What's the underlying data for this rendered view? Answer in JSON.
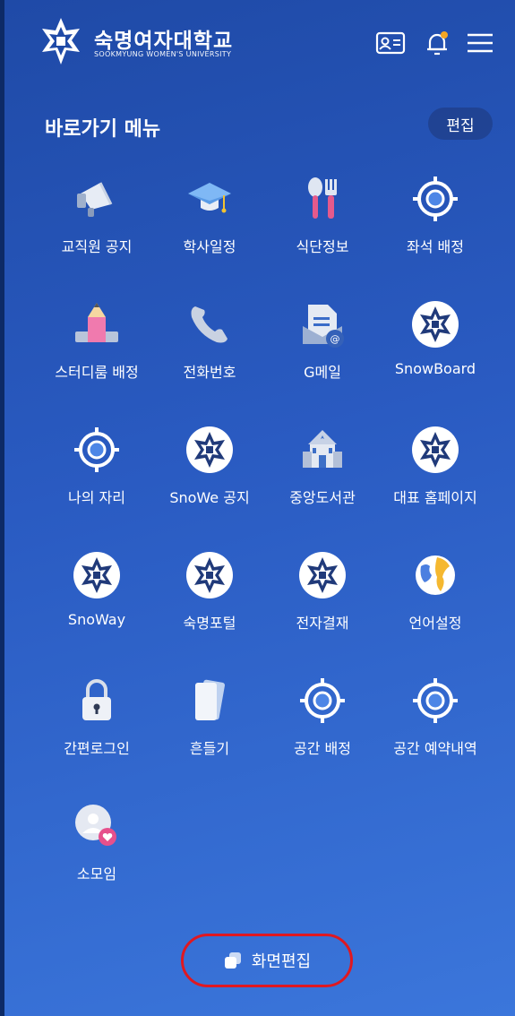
{
  "header": {
    "brand_name": "숙명여자대학교",
    "brand_sub": "SOOKMYUNG WOMEN'S UNIVERSITY",
    "icons": [
      "id-card-icon",
      "bell-icon",
      "menu-icon"
    ]
  },
  "section": {
    "title": "바로가기 메뉴",
    "edit_label": "편집"
  },
  "menu": [
    {
      "label": "교직원 공지",
      "icon": "megaphone-icon"
    },
    {
      "label": "학사일정",
      "icon": "graduation-cap-icon"
    },
    {
      "label": "식단정보",
      "icon": "utensils-icon"
    },
    {
      "label": "좌석 배정",
      "icon": "target-icon"
    },
    {
      "label": "스터디룸 배정",
      "icon": "pencil-icon"
    },
    {
      "label": "전화번호",
      "icon": "phone-icon"
    },
    {
      "label": "G메일",
      "icon": "mail-icon"
    },
    {
      "label": "SnowBoard",
      "icon": "snowflake-logo-icon"
    },
    {
      "label": "나의 자리",
      "icon": "target-icon"
    },
    {
      "label": "SnoWe 공지",
      "icon": "snowflake-logo-icon"
    },
    {
      "label": "중앙도서관",
      "icon": "library-icon"
    },
    {
      "label": "대표 홈페이지",
      "icon": "snowflake-logo-icon"
    },
    {
      "label": "SnoWay",
      "icon": "snowflake-logo-icon"
    },
    {
      "label": "숙명포털",
      "icon": "snowflake-logo-icon"
    },
    {
      "label": "전자결재",
      "icon": "snowflake-logo-icon"
    },
    {
      "label": "언어설정",
      "icon": "globe-icon"
    },
    {
      "label": "간편로그인",
      "icon": "lock-icon"
    },
    {
      "label": "흔들기",
      "icon": "phone-shake-icon"
    },
    {
      "label": "공간 배정",
      "icon": "target-icon"
    },
    {
      "label": "공간 예약내역",
      "icon": "target-icon"
    },
    {
      "label": "소모임",
      "icon": "group-heart-icon"
    }
  ],
  "footer": {
    "button_label": "화면편집",
    "icon": "copy-icon"
  },
  "colors": {
    "bg_start": "#1f4aa7",
    "bg_end": "#3b76db",
    "highlight": "#e01820",
    "accent_pink": "#e6508c"
  }
}
